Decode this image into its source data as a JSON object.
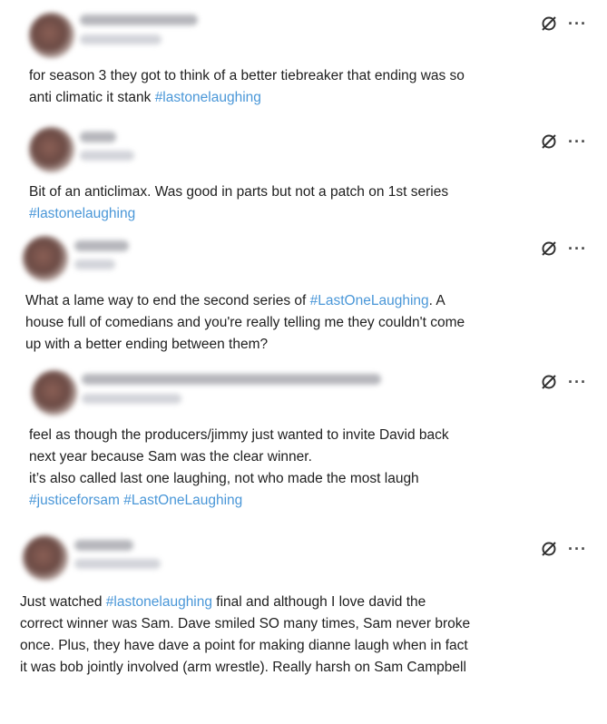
{
  "tweets": [
    {
      "lines": [
        [
          {
            "t": "for season 3 they got to think of a better tiebreaker that ending was so"
          }
        ],
        [
          {
            "t": "anti climatic it stank "
          },
          {
            "t": "#lastonelaughing",
            "tag": true
          }
        ]
      ]
    },
    {
      "lines": [
        [
          {
            "t": "Bit of an anticlimax. Was good in parts but not a patch on 1st series"
          }
        ],
        [
          {
            "t": "#lastonelaughing",
            "tag": true
          }
        ]
      ]
    },
    {
      "lines": [
        [
          {
            "t": "What a lame way to end the second series of "
          },
          {
            "t": "#LastOneLaughing",
            "tag": true
          },
          {
            "t": ". A"
          }
        ],
        [
          {
            "t": "house full of comedians and you're really telling me they couldn't come"
          }
        ],
        [
          {
            "t": "up with a better ending between them?"
          }
        ]
      ]
    },
    {
      "lines": [
        [
          {
            "t": "feel as though the producers/jimmy just wanted to invite David back"
          }
        ],
        [
          {
            "t": "next year because Sam was the clear winner."
          }
        ],
        [
          {
            "t": "it’s also called last one laughing, not who made the most laugh"
          }
        ],
        [
          {
            "t": "#justiceforsam",
            "tag": true
          },
          {
            "t": " "
          },
          {
            "t": "#LastOneLaughing",
            "tag": true
          }
        ]
      ]
    },
    {
      "lines": [
        [
          {
            "t": "Just watched "
          },
          {
            "t": "#lastonelaughing",
            "tag": true
          },
          {
            "t": " final and although I love david the"
          }
        ],
        [
          {
            "t": "correct winner was Sam. Dave smiled SO many times, Sam never broke"
          }
        ],
        [
          {
            "t": "once. Plus, they have dave a point for making dianne laugh when in fact"
          }
        ],
        [
          {
            "t": "it was bob jointly involved (arm wrestle). Really harsh on Sam Campbell"
          }
        ]
      ]
    }
  ],
  "more_label": "···",
  "icons": {
    "grok": "slashed-circle-icon",
    "more": "more-dots-icon"
  },
  "colors": {
    "hashtag": "#4a97d8",
    "text": "#202020"
  }
}
